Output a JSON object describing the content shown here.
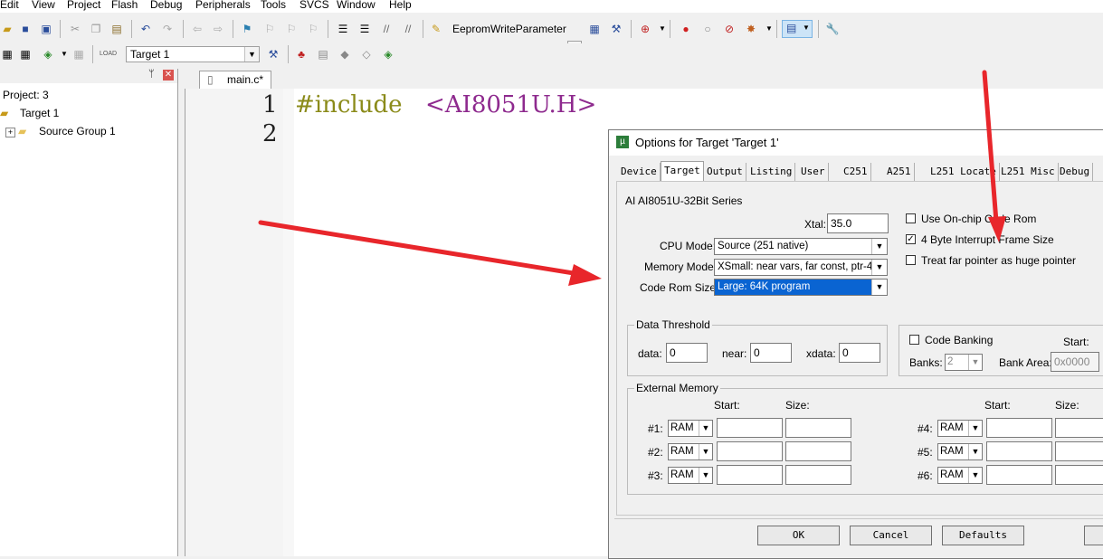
{
  "menu": [
    "Edit",
    "View",
    "Project",
    "Flash",
    "Debug",
    "Peripherals",
    "Tools",
    "SVCS",
    "Window",
    "Help"
  ],
  "toolbar1": {
    "function_combo": "EepromWriteParameter"
  },
  "toolbar2": {
    "target_combo": "Target 1"
  },
  "project": {
    "root": "Project: 3",
    "target": "Target 1",
    "group": "Source Group 1",
    "pin_icon": "pin-icon",
    "close_icon": "close-icon"
  },
  "editor": {
    "tab": "main.c*",
    "lines": [
      {
        "no": "1",
        "pre": "#include ",
        "header": "<AI8051U.H>"
      },
      {
        "no": "2",
        "pre": "",
        "header": ""
      }
    ]
  },
  "dialog": {
    "title": "Options for Target 'Target 1'",
    "tabs": [
      "Device",
      "Target",
      "Output",
      "Listing",
      "User",
      "C251",
      "A251",
      "L251 Locate",
      "L251 Misc",
      "Debug"
    ],
    "active_tab": "Target",
    "device": "AI AI8051U-32Bit Series",
    "xtal_label": "Xtal:",
    "xtal_value": "35.0",
    "cpu_mode_label": "CPU Mode:",
    "cpu_mode_value": "Source (251 native)",
    "memory_model_label": "Memory Model:",
    "memory_model_value": "XSmall: near vars, far const, ptr-4",
    "code_rom_label": "Code Rom Size:",
    "code_rom_value": "Large: 64K program",
    "opt_onchip": "Use On-chip Code Rom",
    "opt_4byte": "4 Byte Interrupt Frame Size",
    "opt_farptr": "Treat far pointer as huge pointer",
    "data_threshold": {
      "title": "Data Threshold",
      "data_label": "data:",
      "data_value": "0",
      "near_label": "near:",
      "near_value": "0",
      "xdata_label": "xdata:",
      "xdata_value": "0"
    },
    "code_banking": {
      "label": "Code Banking",
      "start_label": "Start:",
      "banks_label": "Banks:",
      "banks_value": "2",
      "bank_area_label": "Bank Area:",
      "bank_area_value": "0x0000"
    },
    "external_memory": {
      "title": "External Memory",
      "start_label": "Start:",
      "size_label": "Size:",
      "rows_left": [
        {
          "label": "#1:",
          "type": "RAM"
        },
        {
          "label": "#2:",
          "type": "RAM"
        },
        {
          "label": "#3:",
          "type": "RAM"
        }
      ],
      "rows_right": [
        {
          "label": "#4:",
          "type": "RAM"
        },
        {
          "label": "#5:",
          "type": "RAM"
        },
        {
          "label": "#6:",
          "type": "RAM"
        }
      ]
    },
    "buttons": {
      "ok": "OK",
      "cancel": "Cancel",
      "defaults": "Defaults"
    }
  },
  "colors": {
    "selection": "#0a64d2",
    "annotation_arrow": "#e8262b",
    "include_keyword": "#8b8b1a",
    "header_name": "#8e2a8e"
  }
}
